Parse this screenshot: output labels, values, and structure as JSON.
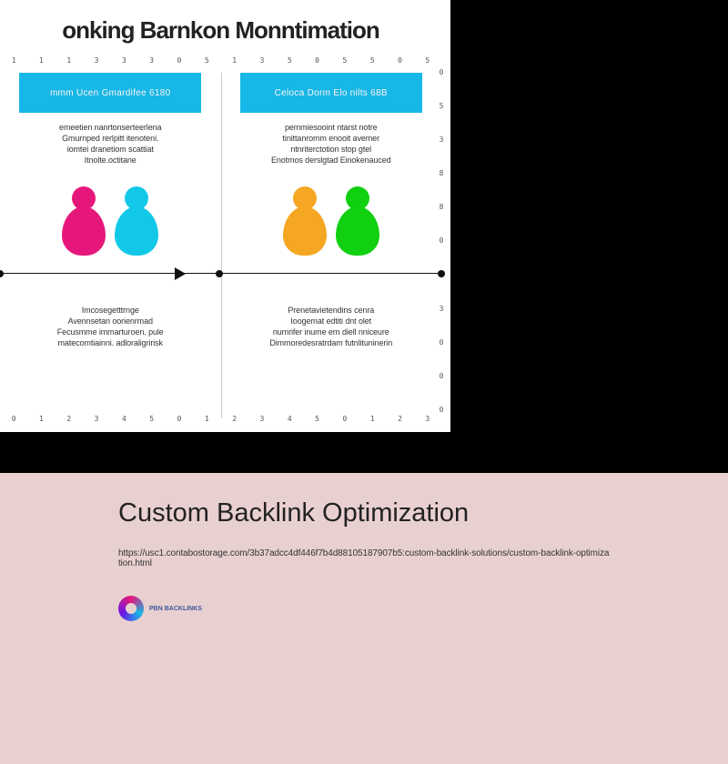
{
  "diagram": {
    "title": "onking Barnkon Monntimation",
    "top_ticks": [
      "1",
      "1",
      "1",
      "3",
      "3",
      "3",
      "0",
      "5",
      "1",
      "3",
      "5",
      "0",
      "5",
      "5",
      "0",
      "5"
    ],
    "bottom_ticks": [
      "0",
      "1",
      "2",
      "3",
      "4",
      "5",
      "0",
      "1",
      "2",
      "3",
      "4",
      "5",
      "0",
      "1",
      "2",
      "3"
    ],
    "right_ticks": [
      "0",
      "5",
      "3",
      "8",
      "8",
      "0",
      "0",
      "3",
      "0",
      "0",
      "0"
    ],
    "panels": [
      {
        "header": "mmm Ucen Gmardifee 6180",
        "body": "emeetien nanrtonserteerlena\nGmurnped rerlpitt itenoteni.\niomtei dranetiom scattiat\nItnolte.octitane",
        "lower": "Imcosegetttrnge\nAvennsetan oorienrmad\nFecusmme immarturoen. pule\nmatecomtiainni. adloraligririsk"
      },
      {
        "header": "Celoca Dorm Elo nilts 68B",
        "body": "pemmiesooint ntarst notre\ntinittanromm enooit avemer\nntnriterctotion stop gtel\nEnotmos derslgtad Einokenauced",
        "lower": "Prenetavietendins cenra\nIoogemat edtiti dnt olet\nnumrifer inume ern diell nniceure\nDimmoredesratrdam futnlituninerin"
      }
    ],
    "icon_colors": {
      "left_a": "#e6177a",
      "left_b": "#12c8e8",
      "right_a": "#f5a623",
      "right_b": "#10d010"
    }
  },
  "pink": {
    "title": "Custom Backlink Optimization",
    "url": "https://usc1.contabostorage.com/3b37adcc4df446f7b4d88105187907b5:custom-backlink-solutions/custom-backlink-optimization.html",
    "logo_text": "PBN BACKLINKS"
  }
}
